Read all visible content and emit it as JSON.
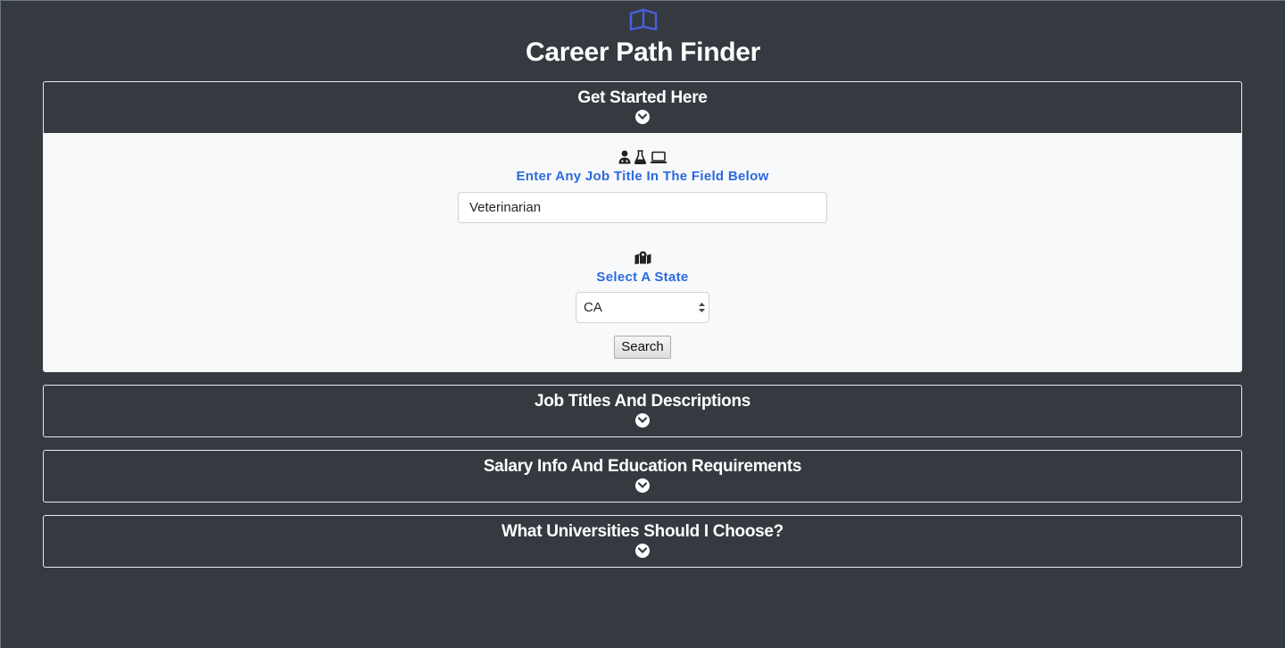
{
  "header": {
    "logo_icon": "book-open-icon",
    "title": "Career Path Finder"
  },
  "sections": [
    {
      "title": "Get Started Here",
      "expanded": true,
      "toggle_icon": "chevron-circle-down-icon"
    },
    {
      "title": "Job Titles And Descriptions",
      "expanded": false,
      "toggle_icon": "chevron-circle-down-icon"
    },
    {
      "title": "Salary Info And Education Requirements",
      "expanded": false,
      "toggle_icon": "chevron-circle-down-icon"
    },
    {
      "title": "What Universities Should I Choose?",
      "expanded": false,
      "toggle_icon": "chevron-circle-down-icon"
    }
  ],
  "get_started": {
    "job_icons": [
      "user-doctor-icon",
      "flask-icon",
      "laptop-icon"
    ],
    "job_label": "Enter Any Job Title In The Field Below",
    "job_value": "Veterinarian",
    "state_icon": "map-marker-icon",
    "state_label": "Select A State",
    "state_value": "CA",
    "search_label": "Search"
  },
  "colors": {
    "background": "#343a40",
    "panel": "#f8f9fa",
    "label_blue": "#2b6ae0",
    "logo_blue": "#4a5fe0"
  }
}
